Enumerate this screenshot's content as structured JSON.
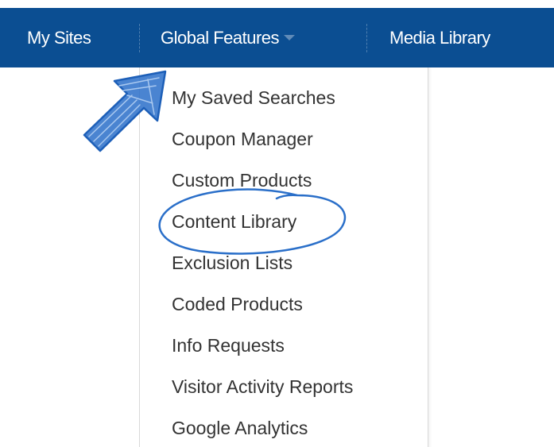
{
  "nav": {
    "items": [
      {
        "label": "My Sites"
      },
      {
        "label": "Global Features"
      },
      {
        "label": "Media Library"
      }
    ]
  },
  "menu": {
    "items": [
      {
        "label": "My Saved Searches"
      },
      {
        "label": "Coupon Manager"
      },
      {
        "label": "Custom Products"
      },
      {
        "label": "Content Library"
      },
      {
        "label": "Exclusion Lists"
      },
      {
        "label": "Coded Products"
      },
      {
        "label": "Info Requests"
      },
      {
        "label": "Visitor Activity Reports"
      },
      {
        "label": "Google Analytics"
      }
    ]
  },
  "colors": {
    "nav_bg": "#0b4e92",
    "annotation": "#2a6fc9"
  },
  "annotations": {
    "arrow_target": "Global Features",
    "circled_item": "Content Library"
  }
}
